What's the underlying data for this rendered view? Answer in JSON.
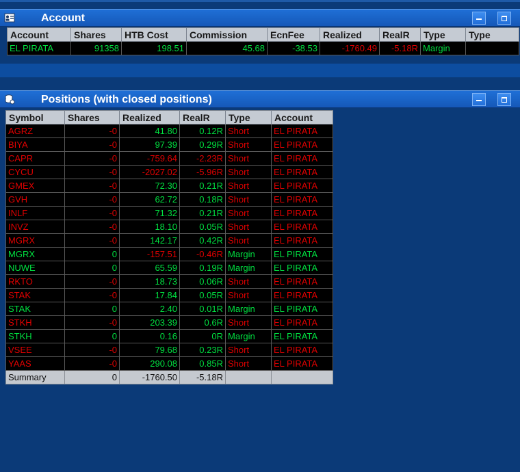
{
  "account_panel": {
    "title": "Account",
    "columns": [
      "Account",
      "Shares",
      "HTB Cost",
      "Commission",
      "EcnFee",
      "Realized",
      "RealR",
      "Type",
      "Type"
    ],
    "rows": [
      {
        "account": "EL PIRATA",
        "shares": "91358",
        "htb_cost": "198.51",
        "commission": "45.68",
        "ecnfee": "-38.53",
        "realized": "-1760.49",
        "realr": "-5.18R",
        "type": "Margin",
        "type2": ""
      }
    ]
  },
  "positions_panel": {
    "title": "Positions (with closed positions)",
    "columns": [
      "Symbol",
      "Shares",
      "Realized",
      "RealR",
      "Type",
      "Account"
    ],
    "rows": [
      {
        "symbol": "AGRZ",
        "shares": "-0",
        "realized": "41.80",
        "realr": "0.12R",
        "type": "Short",
        "account": "EL PIRATA"
      },
      {
        "symbol": "BIYA",
        "shares": "-0",
        "realized": "97.39",
        "realr": "0.29R",
        "type": "Short",
        "account": "EL PIRATA"
      },
      {
        "symbol": "CAPR",
        "shares": "-0",
        "realized": "-759.64",
        "realr": "-2.23R",
        "type": "Short",
        "account": "EL PIRATA"
      },
      {
        "symbol": "CYCU",
        "shares": "-0",
        "realized": "-2027.02",
        "realr": "-5.96R",
        "type": "Short",
        "account": "EL PIRATA"
      },
      {
        "symbol": "GMEX",
        "shares": "-0",
        "realized": "72.30",
        "realr": "0.21R",
        "type": "Short",
        "account": "EL PIRATA"
      },
      {
        "symbol": "GVH",
        "shares": "-0",
        "realized": "62.72",
        "realr": "0.18R",
        "type": "Short",
        "account": "EL PIRATA"
      },
      {
        "symbol": "INLF",
        "shares": "-0",
        "realized": "71.32",
        "realr": "0.21R",
        "type": "Short",
        "account": "EL PIRATA"
      },
      {
        "symbol": "INVZ",
        "shares": "-0",
        "realized": "18.10",
        "realr": "0.05R",
        "type": "Short",
        "account": "EL PIRATA"
      },
      {
        "symbol": "MGRX",
        "shares": "-0",
        "realized": "142.17",
        "realr": "0.42R",
        "type": "Short",
        "account": "EL PIRATA"
      },
      {
        "symbol": "MGRX",
        "shares": "0",
        "realized": "-157.51",
        "realr": "-0.46R",
        "type": "Margin",
        "account": "EL PIRATA"
      },
      {
        "symbol": "NUWE",
        "shares": "0",
        "realized": "65.59",
        "realr": "0.19R",
        "type": "Margin",
        "account": "EL PIRATA"
      },
      {
        "symbol": "RKTO",
        "shares": "-0",
        "realized": "18.73",
        "realr": "0.06R",
        "type": "Short",
        "account": "EL PIRATA"
      },
      {
        "symbol": "STAK",
        "shares": "-0",
        "realized": "17.84",
        "realr": "0.05R",
        "type": "Short",
        "account": "EL PIRATA"
      },
      {
        "symbol": "STAK",
        "shares": "0",
        "realized": "2.40",
        "realr": "0.01R",
        "type": "Margin",
        "account": "EL PIRATA"
      },
      {
        "symbol": "STKH",
        "shares": "-0",
        "realized": "203.39",
        "realr": "0.6R",
        "type": "Short",
        "account": "EL PIRATA"
      },
      {
        "symbol": "STKH",
        "shares": "0",
        "realized": "0.16",
        "realr": "0R",
        "type": "Margin",
        "account": "EL PIRATA"
      },
      {
        "symbol": "VSEE",
        "shares": "-0",
        "realized": "79.68",
        "realr": "0.23R",
        "type": "Short",
        "account": "EL PIRATA"
      },
      {
        "symbol": "YAAS",
        "shares": "-0",
        "realized": "290.08",
        "realr": "0.85R",
        "type": "Short",
        "account": "EL PIRATA"
      }
    ],
    "summary": {
      "symbol": "Summary",
      "shares": "0",
      "realized": "-1760.50",
      "realr": "-5.18R",
      "type": "",
      "account": ""
    }
  },
  "colors": {
    "background": "#0b3a78",
    "titlebar": "#1a64c8",
    "positive": "#00e040",
    "negative": "#e00000"
  }
}
